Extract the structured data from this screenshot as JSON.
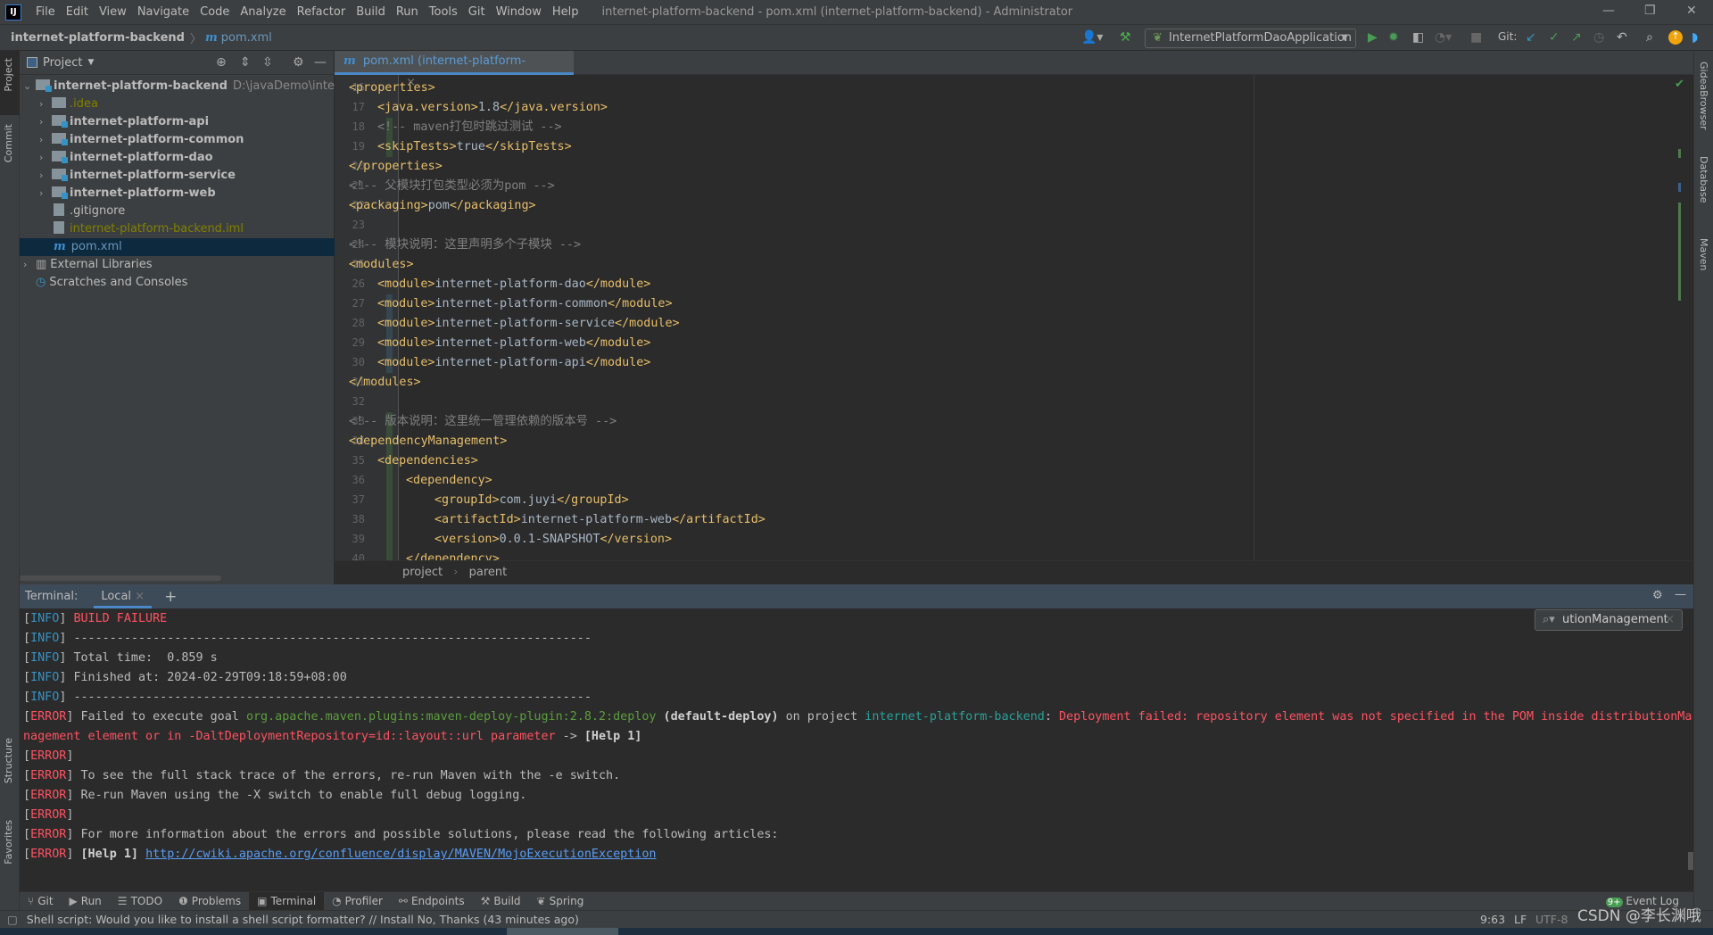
{
  "window": {
    "logo": "IJ",
    "title": "internet-platform-backend - pom.xml (internet-platform-backend) - Administrator",
    "minimize": "—",
    "restore": "❐",
    "close": "✕"
  },
  "menu": [
    "File",
    "Edit",
    "View",
    "Navigate",
    "Code",
    "Analyze",
    "Refactor",
    "Build",
    "Run",
    "Tools",
    "Git",
    "Window",
    "Help"
  ],
  "navbar": {
    "project": "internet-platform-backend",
    "file": "pom.xml",
    "run_config": "InternetPlatformDaoApplication",
    "git_label": "Git:"
  },
  "left_stripe": {
    "project": "Project",
    "commit": "Commit",
    "structure": "Structure",
    "favorites": "Favorites"
  },
  "right_stripe": {
    "browser": "GideaBrowser",
    "database": "Database",
    "maven": "Maven"
  },
  "project_panel": {
    "title": "Project",
    "root": {
      "name": "internet-platform-backend",
      "path": "D:\\javaDemo\\internetPla"
    },
    "items": [
      {
        "name": ".idea",
        "kind": "folder",
        "color": "#808000",
        "expandable": true
      },
      {
        "name": "internet-platform-api",
        "kind": "module",
        "color": "#bbbbbb",
        "expandable": true
      },
      {
        "name": "internet-platform-common",
        "kind": "module",
        "color": "#bbbbbb",
        "expandable": true
      },
      {
        "name": "internet-platform-dao",
        "kind": "module",
        "color": "#bbbbbb",
        "expandable": true
      },
      {
        "name": "internet-platform-service",
        "kind": "module",
        "color": "#bbbbbb",
        "expandable": true
      },
      {
        "name": "internet-platform-web",
        "kind": "module",
        "color": "#bbbbbb",
        "expandable": true
      },
      {
        "name": ".gitignore",
        "kind": "file",
        "color": "#bbbbbb",
        "expandable": false
      },
      {
        "name": "internet-platform-backend.iml",
        "kind": "file",
        "color": "#808000",
        "expandable": false
      },
      {
        "name": "pom.xml",
        "kind": "maven",
        "color": "#6897bb",
        "expandable": false,
        "selected": true
      }
    ],
    "external_libraries": "External Libraries",
    "scratches": "Scratches and Consoles"
  },
  "editor": {
    "tab_label": "pom.xml (internet-platform-backend)",
    "breadcrumb": [
      "project",
      "parent"
    ],
    "colors": {
      "tag": "#e8bf6a",
      "text": "#a9b7c6",
      "comment": "#808080"
    },
    "lines": [
      {
        "n": "16",
        "indent": 1,
        "change": "",
        "segs": [
          [
            "tag",
            "<properties>"
          ]
        ]
      },
      {
        "n": "17",
        "indent": 2,
        "change": "",
        "segs": [
          [
            "tag",
            "<java.version>"
          ],
          [
            "text",
            "1.8"
          ],
          [
            "tag",
            "</java.version>"
          ]
        ]
      },
      {
        "n": "18",
        "indent": 2,
        "change": "added",
        "segs": [
          [
            "comment",
            "<!-- maven打包时跳过测试 -->"
          ]
        ]
      },
      {
        "n": "19",
        "indent": 2,
        "change": "added",
        "segs": [
          [
            "tag",
            "<skipTests>"
          ],
          [
            "text",
            "true"
          ],
          [
            "tag",
            "</skipTests>"
          ]
        ]
      },
      {
        "n": "20",
        "indent": 1,
        "change": "",
        "segs": [
          [
            "tag",
            "</properties>"
          ]
        ]
      },
      {
        "n": "21",
        "indent": 1,
        "change": "",
        "segs": [
          [
            "comment",
            "<!-- 父模块打包类型必须为pom -->"
          ]
        ]
      },
      {
        "n": "22",
        "indent": 1,
        "change": "",
        "segs": [
          [
            "tag",
            "<packaging>"
          ],
          [
            "text",
            "pom"
          ],
          [
            "tag",
            "</packaging>"
          ]
        ]
      },
      {
        "n": "23",
        "indent": 1,
        "change": "",
        "segs": []
      },
      {
        "n": "24",
        "indent": 1,
        "change": "",
        "segs": [
          [
            "comment",
            "<!-- 模块说明：这里声明多个子模块 -->"
          ]
        ]
      },
      {
        "n": "25",
        "indent": 1,
        "change": "",
        "segs": [
          [
            "tag",
            "<modules>"
          ]
        ]
      },
      {
        "n": "26",
        "indent": 2,
        "change": "",
        "segs": [
          [
            "tag",
            "<module>"
          ],
          [
            "text",
            "internet-platform-dao"
          ],
          [
            "tag",
            "</module>"
          ]
        ]
      },
      {
        "n": "27",
        "indent": 2,
        "change": "modified",
        "segs": [
          [
            "tag",
            "<module>"
          ],
          [
            "text",
            "internet-platform-common"
          ],
          [
            "tag",
            "</module>"
          ]
        ]
      },
      {
        "n": "28",
        "indent": 2,
        "change": "modified",
        "segs": [
          [
            "tag",
            "<module>"
          ],
          [
            "text",
            "internet-platform-service"
          ],
          [
            "tag",
            "</module>"
          ]
        ]
      },
      {
        "n": "29",
        "indent": 2,
        "change": "modified",
        "segs": [
          [
            "tag",
            "<module>"
          ],
          [
            "text",
            "internet-platform-web"
          ],
          [
            "tag",
            "</module>"
          ]
        ]
      },
      {
        "n": "30",
        "indent": 2,
        "change": "modified",
        "segs": [
          [
            "tag",
            "<module>"
          ],
          [
            "text",
            "internet-platform-api"
          ],
          [
            "tag",
            "</module>"
          ]
        ]
      },
      {
        "n": "31",
        "indent": 1,
        "change": "",
        "segs": [
          [
            "tag",
            "</modules>"
          ]
        ]
      },
      {
        "n": "32",
        "indent": 1,
        "change": "",
        "segs": []
      },
      {
        "n": "33",
        "indent": 1,
        "change": "added",
        "segs": [
          [
            "comment",
            "<!-- 版本说明：这里统一管理依赖的版本号 -->"
          ]
        ]
      },
      {
        "n": "34",
        "indent": 1,
        "change": "added",
        "segs": [
          [
            "tag",
            "<dependencyManagement>"
          ]
        ]
      },
      {
        "n": "35",
        "indent": 2,
        "change": "added",
        "segs": [
          [
            "tag",
            "<dependencies>"
          ]
        ]
      },
      {
        "n": "36",
        "indent": 3,
        "change": "added",
        "segs": [
          [
            "tag",
            "<dependency>"
          ]
        ]
      },
      {
        "n": "37",
        "indent": 4,
        "change": "added",
        "segs": [
          [
            "tag",
            "<groupId>"
          ],
          [
            "text",
            "com.juyi"
          ],
          [
            "tag",
            "</groupId>"
          ]
        ]
      },
      {
        "n": "38",
        "indent": 4,
        "change": "added",
        "segs": [
          [
            "tag",
            "<artifactId>"
          ],
          [
            "text",
            "internet-platform-web"
          ],
          [
            "tag",
            "</artifactId>"
          ]
        ]
      },
      {
        "n": "39",
        "indent": 4,
        "change": "added",
        "segs": [
          [
            "tag",
            "<version>"
          ],
          [
            "text",
            "0.0.1-SNAPSHOT"
          ],
          [
            "tag",
            "</version>"
          ]
        ]
      },
      {
        "n": "40",
        "indent": 3,
        "change": "added",
        "segs": [
          [
            "tag",
            "</dependency>"
          ]
        ]
      }
    ]
  },
  "terminal": {
    "label": "Terminal:",
    "tab": "Local",
    "search_value": "utionManagement",
    "colors": {
      "br": "#bbbbbb",
      "info": "#3592c4",
      "err": "#ff5261",
      "plain": "#bbbbbb",
      "green": "#5c9e3e",
      "teal": "#2aa198",
      "bold": "#d0d0d0",
      "link": "#589df6"
    },
    "lines": [
      [
        [
          "br",
          "["
        ],
        [
          "info",
          "INFO"
        ],
        [
          "br",
          "] "
        ],
        [
          "err",
          "BUILD FAILURE"
        ]
      ],
      [
        [
          "br",
          "["
        ],
        [
          "info",
          "INFO"
        ],
        [
          "br",
          "] "
        ],
        [
          "plain",
          "------------------------------------------------------------------------"
        ]
      ],
      [
        [
          "br",
          "["
        ],
        [
          "info",
          "INFO"
        ],
        [
          "br",
          "] "
        ],
        [
          "plain",
          "Total time:  0.859 s"
        ]
      ],
      [
        [
          "br",
          "["
        ],
        [
          "info",
          "INFO"
        ],
        [
          "br",
          "] "
        ],
        [
          "plain",
          "Finished at: 2024-02-29T09:18:59+08:00"
        ]
      ],
      [
        [
          "br",
          "["
        ],
        [
          "info",
          "INFO"
        ],
        [
          "br",
          "] "
        ],
        [
          "plain",
          "------------------------------------------------------------------------"
        ]
      ],
      [
        [
          "br",
          "["
        ],
        [
          "err",
          "ERROR"
        ],
        [
          "br",
          "] "
        ],
        [
          "plain",
          "Failed to execute goal "
        ],
        [
          "green",
          "org.apache.maven.plugins:maven-deploy-plugin:2.8.2:deploy"
        ],
        [
          "bold",
          " (default-deploy)"
        ],
        [
          "plain",
          " on project "
        ],
        [
          "teal",
          "internet-platform-backend"
        ],
        [
          "plain",
          ": "
        ],
        [
          "err",
          "Deployment failed: repository element was not specified in the POM inside distributionMa"
        ]
      ],
      [
        [
          "err",
          "nagement element or in -DaltDeploymentRepository=id::layout::url parameter"
        ],
        [
          "plain",
          " -> "
        ],
        [
          "bold",
          "[Help 1]"
        ]
      ],
      [
        [
          "br",
          "["
        ],
        [
          "err",
          "ERROR"
        ],
        [
          "br",
          "]"
        ]
      ],
      [
        [
          "br",
          "["
        ],
        [
          "err",
          "ERROR"
        ],
        [
          "br",
          "] "
        ],
        [
          "plain",
          "To see the full stack trace of the errors, re-run Maven with the -e switch."
        ]
      ],
      [
        [
          "br",
          "["
        ],
        [
          "err",
          "ERROR"
        ],
        [
          "br",
          "] "
        ],
        [
          "plain",
          "Re-run Maven using the -X switch to enable full debug logging."
        ]
      ],
      [
        [
          "br",
          "["
        ],
        [
          "err",
          "ERROR"
        ],
        [
          "br",
          "]"
        ]
      ],
      [
        [
          "br",
          "["
        ],
        [
          "err",
          "ERROR"
        ],
        [
          "br",
          "] "
        ],
        [
          "plain",
          "For more information about the errors and possible solutions, please read the following articles:"
        ]
      ],
      [
        [
          "br",
          "["
        ],
        [
          "err",
          "ERROR"
        ],
        [
          "br",
          "] "
        ],
        [
          "bold",
          "[Help 1] "
        ],
        [
          "link",
          "http://cwiki.apache.org/confluence/display/MAVEN/MojoExecutionException"
        ]
      ]
    ]
  },
  "tool_windows": [
    "Git",
    "Run",
    "TODO",
    "Problems",
    "Terminal",
    "Profiler",
    "Endpoints",
    "Build",
    "Spring"
  ],
  "tool_active": "Terminal",
  "event_log": {
    "badge": "9+",
    "label": "Event Log"
  },
  "status": {
    "message": "Shell script: Would you like to install a shell script formatter? // Install   No, Thanks (43 minutes ago)",
    "position": "9:63",
    "line_sep": "LF",
    "encoding": "UTF-8",
    "watermark": "CSDN @李长渊哦"
  }
}
